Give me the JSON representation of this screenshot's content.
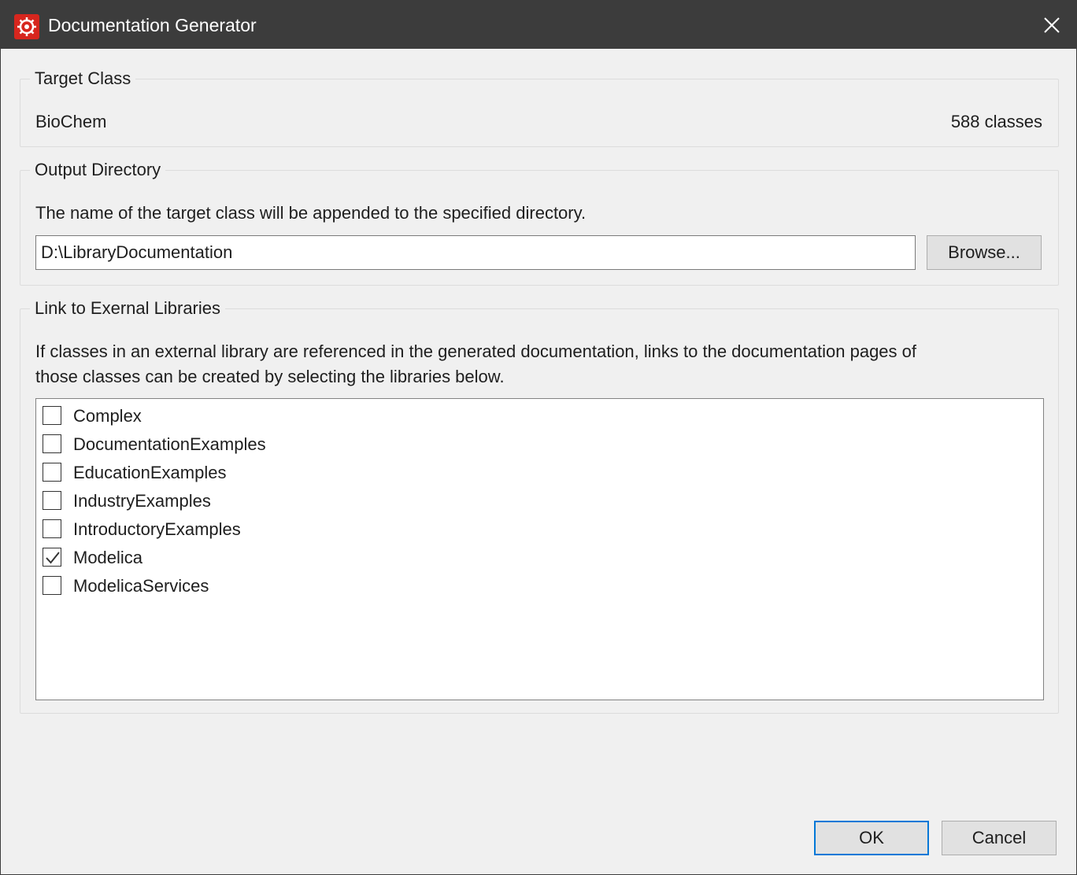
{
  "window": {
    "title": "Documentation Generator",
    "app_icon": "modelica-app-icon",
    "close_icon": "close-icon"
  },
  "target_class": {
    "legend": "Target Class",
    "name": "BioChem",
    "count": "588 classes"
  },
  "output_directory": {
    "legend": "Output Directory",
    "description": "The name of the target class will be appended to the specified directory.",
    "path": "D:\\LibraryDocumentation",
    "browse_label": "Browse..."
  },
  "external_libraries": {
    "legend": "Link to Exernal Libraries",
    "description_line1": "If classes in an external library are referenced in the generated documentation, links to the documentation pages of",
    "description_line2": "those classes can be created by selecting the libraries below.",
    "items": [
      {
        "label": "Complex",
        "checked": false
      },
      {
        "label": "DocumentationExamples",
        "checked": false
      },
      {
        "label": "EducationExamples",
        "checked": false
      },
      {
        "label": "IndustryExamples",
        "checked": false
      },
      {
        "label": "IntroductoryExamples",
        "checked": false
      },
      {
        "label": "Modelica",
        "checked": true
      },
      {
        "label": "ModelicaServices",
        "checked": false
      }
    ]
  },
  "buttons": {
    "ok_label": "OK",
    "cancel_label": "Cancel"
  },
  "colors": {
    "titlebar": "#3c3c3c",
    "dialog_background": "#f0f0f0",
    "app_icon": "#d7261e",
    "default_button_border": "#0078d7"
  }
}
